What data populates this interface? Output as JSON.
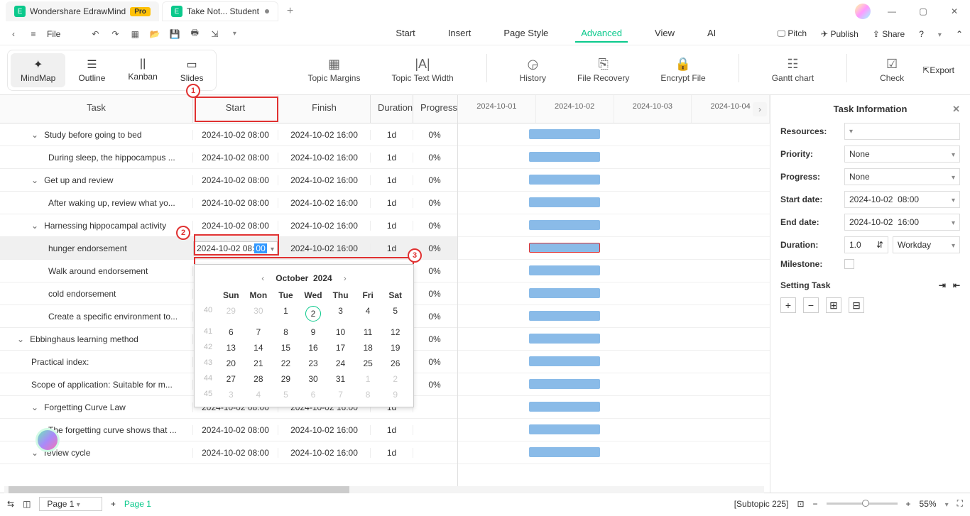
{
  "titlebar": {
    "app_name": "Wondershare EdrawMind",
    "pro_badge": "Pro",
    "doc_tab": "Take Not... Student"
  },
  "top_toolbar": {
    "file": "File",
    "menu": {
      "start": "Start",
      "insert": "Insert",
      "page_style": "Page Style",
      "advanced": "Advanced",
      "view": "View",
      "ai": "AI"
    },
    "right": {
      "pitch": "Pitch",
      "publish": "Publish",
      "share": "Share"
    }
  },
  "views": {
    "mindmap": "MindMap",
    "outline": "Outline",
    "kanban": "Kanban",
    "slides": "Slides"
  },
  "ribbon": {
    "topic_margins": "Topic Margins",
    "topic_text_width": "Topic Text Width",
    "history": "History",
    "file_recovery": "File Recovery",
    "encrypt_file": "Encrypt File",
    "gantt_chart": "Gantt chart",
    "check": "Check",
    "export": "Export"
  },
  "gantt_headers": {
    "task": "Task",
    "start": "Start",
    "finish": "Finish",
    "duration": "Duration",
    "progress": "Progress"
  },
  "timeline_dates": [
    "2024-10-01",
    "2024-10-02",
    "2024-10-03",
    "2024-10-04"
  ],
  "rows": [
    {
      "indent": 1,
      "expand": true,
      "name": "Study before going to bed",
      "start": "2024-10-02 08:00",
      "finish": "2024-10-02 16:00",
      "dur": "1d",
      "prog": "0%"
    },
    {
      "indent": 2,
      "expand": false,
      "name": "During sleep, the hippocampus ...",
      "start": "2024-10-02 08:00",
      "finish": "2024-10-02 16:00",
      "dur": "1d",
      "prog": "0%"
    },
    {
      "indent": 1,
      "expand": true,
      "name": "Get up and review",
      "start": "2024-10-02 08:00",
      "finish": "2024-10-02 16:00",
      "dur": "1d",
      "prog": "0%"
    },
    {
      "indent": 2,
      "expand": false,
      "name": "After waking up, review what yo...",
      "start": "2024-10-02 08:00",
      "finish": "2024-10-02 16:00",
      "dur": "1d",
      "prog": "0%"
    },
    {
      "indent": 1,
      "expand": true,
      "name": "Harnessing hippocampal activity",
      "start": "2024-10-02 08:00",
      "finish": "2024-10-02 16:00",
      "dur": "1d",
      "prog": "0%"
    },
    {
      "indent": 2,
      "expand": false,
      "name": "hunger endorsement",
      "start_edit": {
        "base": "2024-10-02 08:",
        "sel": "00"
      },
      "finish": "2024-10-02 16:00",
      "dur": "1d",
      "prog": "0%",
      "selected": true
    },
    {
      "indent": 2,
      "expand": false,
      "name": "Walk around endorsement",
      "start": "",
      "finish": "",
      "dur": "",
      "prog": "0%"
    },
    {
      "indent": 2,
      "expand": false,
      "name": "cold endorsement",
      "start": "",
      "finish": "",
      "dur": "",
      "prog": "0%"
    },
    {
      "indent": 2,
      "expand": false,
      "name": "Create a specific environment to...",
      "start": "",
      "finish": "",
      "dur": "",
      "prog": "0%"
    },
    {
      "indent": 0,
      "expand": true,
      "name": "Ebbinghaus learning method",
      "start": "",
      "finish": "",
      "dur": "",
      "prog": "0%"
    },
    {
      "indent": 1,
      "expand": false,
      "name": "Practical index:",
      "start": "",
      "finish": "",
      "dur": "",
      "prog": "0%"
    },
    {
      "indent": 1,
      "expand": false,
      "name": "Scope of application: Suitable for m...",
      "start": "",
      "finish": "",
      "dur": "",
      "prog": "0%"
    },
    {
      "indent": 1,
      "expand": true,
      "name": "Forgetting Curve Law",
      "start": "2024-10-02 08:00",
      "finish": "2024-10-02 16:00",
      "dur": "1d",
      "prog": ""
    },
    {
      "indent": 2,
      "expand": false,
      "name": "The forgetting curve shows that ...",
      "start": "2024-10-02 08:00",
      "finish": "2024-10-02 16:00",
      "dur": "1d",
      "prog": ""
    },
    {
      "indent": 1,
      "expand": true,
      "name": "review cycle",
      "start": "2024-10-02 08:00",
      "finish": "2024-10-02 16:00",
      "dur": "1d",
      "prog": ""
    }
  ],
  "calendar": {
    "month_label": "October",
    "year_label": "2024",
    "weekdays": [
      "Sun",
      "Mon",
      "Tue",
      "Wed",
      "Thu",
      "Fri",
      "Sat"
    ],
    "weeks": [
      {
        "num": "40",
        "days": [
          {
            "d": "29",
            "o": true
          },
          {
            "d": "30",
            "o": true
          },
          {
            "d": "1"
          },
          {
            "d": "2",
            "today": true
          },
          {
            "d": "3"
          },
          {
            "d": "4"
          },
          {
            "d": "5"
          }
        ]
      },
      {
        "num": "41",
        "days": [
          {
            "d": "6"
          },
          {
            "d": "7"
          },
          {
            "d": "8"
          },
          {
            "d": "9"
          },
          {
            "d": "10"
          },
          {
            "d": "11"
          },
          {
            "d": "12"
          }
        ]
      },
      {
        "num": "42",
        "days": [
          {
            "d": "13"
          },
          {
            "d": "14"
          },
          {
            "d": "15"
          },
          {
            "d": "16"
          },
          {
            "d": "17"
          },
          {
            "d": "18"
          },
          {
            "d": "19"
          }
        ]
      },
      {
        "num": "43",
        "days": [
          {
            "d": "20"
          },
          {
            "d": "21"
          },
          {
            "d": "22"
          },
          {
            "d": "23"
          },
          {
            "d": "24"
          },
          {
            "d": "25"
          },
          {
            "d": "26"
          }
        ]
      },
      {
        "num": "44",
        "days": [
          {
            "d": "27"
          },
          {
            "d": "28"
          },
          {
            "d": "29"
          },
          {
            "d": "30"
          },
          {
            "d": "31"
          },
          {
            "d": "1",
            "o": true
          },
          {
            "d": "2",
            "o": true
          }
        ]
      },
      {
        "num": "45",
        "days": [
          {
            "d": "3",
            "o": true
          },
          {
            "d": "4",
            "o": true
          },
          {
            "d": "5",
            "o": true
          },
          {
            "d": "6",
            "o": true
          },
          {
            "d": "7",
            "o": true
          },
          {
            "d": "8",
            "o": true
          },
          {
            "d": "9",
            "o": true
          }
        ]
      }
    ]
  },
  "sidepanel": {
    "title": "Task Information",
    "resources": "Resources:",
    "priority": "Priority:",
    "priority_val": "None",
    "progress": "Progress:",
    "progress_val": "None",
    "start_date": "Start date:",
    "start_date_val": "2024-10-02",
    "start_time_val": "08:00",
    "end_date": "End date:",
    "end_date_val": "2024-10-02",
    "end_time_val": "16:00",
    "duration": "Duration:",
    "duration_val": "1.0",
    "duration_unit": "Workday",
    "milestone": "Milestone:",
    "setting_task": "Setting Task"
  },
  "statusbar": {
    "page_sel": "Page 1",
    "page_indicator": "Page 1",
    "subtopic": "[Subtopic 225]",
    "zoom": "55%"
  }
}
